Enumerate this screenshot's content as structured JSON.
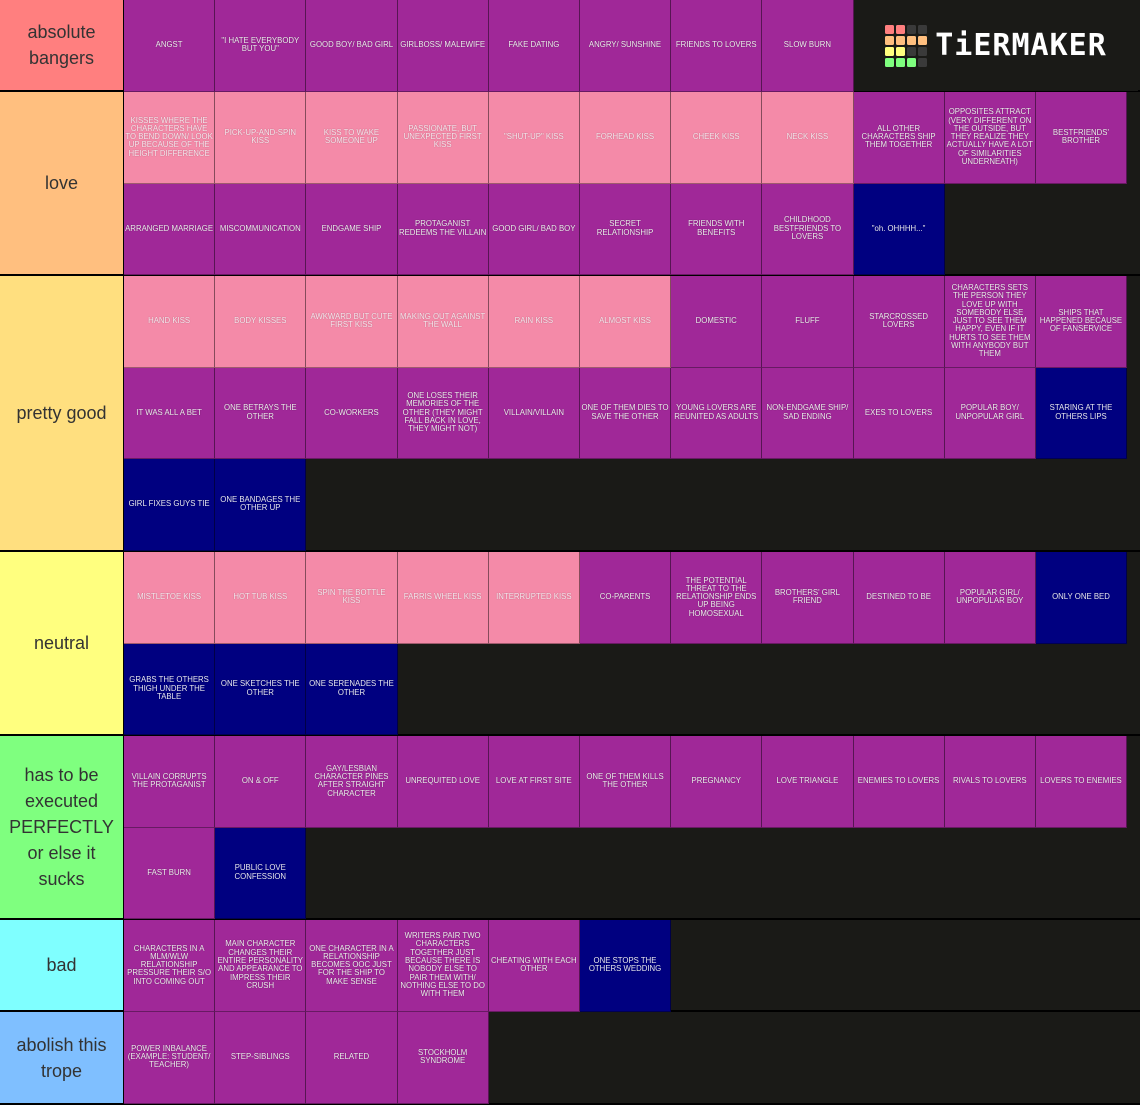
{
  "app": {
    "logo_text": "TiERMAKER",
    "logo_grid_colors": [
      "#ff7f7f",
      "#ff7f7f",
      "#3a3a3a",
      "#3a3a3a",
      "#ffbf7f",
      "#ffbf7f",
      "#ffbf7f",
      "#ffbf7f",
      "#ffff7f",
      "#ffff7f",
      "#3a3a3a",
      "#3a3a3a",
      "#7fff7f",
      "#7fff7f",
      "#7fff7f",
      "#3a3a3a"
    ]
  },
  "colors": {
    "purple": "#a02898",
    "pink": "#f48aa8",
    "navy": "#000080",
    "empty": "#1a1a17"
  },
  "tiers": [
    {
      "label": "absolute bangers",
      "color": "#ff7f7f",
      "items": [
        {
          "text": "ANGST",
          "color": "purple"
        },
        {
          "text": "\"I HATE EVERYBODY BUT YOU\"",
          "color": "purple"
        },
        {
          "text": "GOOD BOY/ BAD GIRL",
          "color": "purple"
        },
        {
          "text": "GIRLBOSS/ MALEWIFE",
          "color": "purple"
        },
        {
          "text": "FAKE DATING",
          "color": "purple"
        },
        {
          "text": "ANGRY/ SUNSHINE",
          "color": "purple"
        },
        {
          "text": "FRIENDS TO LOVERS",
          "color": "purple"
        },
        {
          "text": "SLOW BURN",
          "color": "purple"
        }
      ]
    },
    {
      "label": "love",
      "color": "#ffbf7f",
      "items": [
        {
          "text": "KISSES WHERE THE CHARACTERS HAVE TO BEND DOWN/ LOOK UP BECAUSE OF THE HEIGHT DIFFERENCE",
          "color": "pink"
        },
        {
          "text": "PICK-UP-AND-SPIN KISS",
          "color": "pink"
        },
        {
          "text": "KISS TO WAKE SOMEONE UP",
          "color": "pink"
        },
        {
          "text": "PASSIONATE, BUT UNEXPECTED FIRST KISS",
          "color": "pink"
        },
        {
          "text": "\"SHUT-UP\" KISS",
          "color": "pink"
        },
        {
          "text": "FORHEAD KISS",
          "color": "pink"
        },
        {
          "text": "CHEEK KISS",
          "color": "pink"
        },
        {
          "text": "NECK KISS",
          "color": "pink"
        },
        {
          "text": "ALL OTHER CHARACTERS SHIP THEM TOGETHER",
          "color": "purple"
        },
        {
          "text": "OPPOSITES ATTRACT (VERY DIFFERENT ON THE OUTSIDE, BUT THEY REALIZE THEY ACTUALLY HAVE A LOT OF SIMILARITIES UNDERNEATH)",
          "color": "purple"
        },
        {
          "text": "BESTFRIENDS' BROTHER",
          "color": "purple"
        },
        {
          "text": "ARRANGED MARRIAGE",
          "color": "purple"
        },
        {
          "text": "MISCOMMUNICATION",
          "color": "purple"
        },
        {
          "text": "ENDGAME SHIP",
          "color": "purple"
        },
        {
          "text": "PROTAGANIST REDEEMS THE VILLAIN",
          "color": "purple"
        },
        {
          "text": "GOOD GIRL/ BAD BOY",
          "color": "purple"
        },
        {
          "text": "SECRET RELATIONSHIP",
          "color": "purple"
        },
        {
          "text": "FRIENDS WITH BENEFITS",
          "color": "purple"
        },
        {
          "text": "CHILDHOOD BESTFRIENDS TO LOVERS",
          "color": "purple"
        },
        {
          "text": "\"oh. OHHHH...\"",
          "color": "navy",
          "lower": true
        }
      ]
    },
    {
      "label": "pretty good",
      "color": "#ffdf7f",
      "items": [
        {
          "text": "HAND KISS",
          "color": "pink"
        },
        {
          "text": "BODY KISSES",
          "color": "pink"
        },
        {
          "text": "AWKWARD BUT CUTE FIRST KISS",
          "color": "pink"
        },
        {
          "text": "MAKING OUT AGAINST THE WALL",
          "color": "pink"
        },
        {
          "text": "RAIN KISS",
          "color": "pink"
        },
        {
          "text": "ALMOST KISS",
          "color": "pink"
        },
        {
          "text": "DOMESTIC",
          "color": "purple"
        },
        {
          "text": "FLUFF",
          "color": "purple"
        },
        {
          "text": "STARCROSSED LOVERS",
          "color": "purple"
        },
        {
          "text": "CHARACTERS SETS THE PERSON THEY LOVE UP WITH SOMEBODY ELSE JUST TO SEE THEM HAPPY, EVEN IF IT HURTS TO SEE THEM WITH ANYBODY BUT THEM",
          "color": "purple"
        },
        {
          "text": "SHIPS THAT HAPPENED BECAUSE OF FANSERVICE",
          "color": "purple"
        },
        {
          "text": "IT WAS ALL A BET",
          "color": "purple"
        },
        {
          "text": "ONE BETRAYS THE OTHER",
          "color": "purple"
        },
        {
          "text": "CO-WORKERS",
          "color": "purple"
        },
        {
          "text": "ONE LOSES THEIR MEMORIES OF THE OTHER (THEY MIGHT FALL BACK IN LOVE, THEY MIGHT NOT)",
          "color": "purple"
        },
        {
          "text": "VILLAIN/VILLAIN",
          "color": "purple"
        },
        {
          "text": "ONE OF THEM DIES TO SAVE THE OTHER",
          "color": "purple"
        },
        {
          "text": "YOUNG LOVERS ARE REUNITED AS ADULTS",
          "color": "purple"
        },
        {
          "text": "NON-ENDGAME SHIP/ SAD ENDING",
          "color": "purple"
        },
        {
          "text": "EXES TO LOVERS",
          "color": "purple"
        },
        {
          "text": "POPULAR BOY/ UNPOPULAR GIRL",
          "color": "purple"
        },
        {
          "text": "STARING AT THE OTHERS LIPS",
          "color": "navy"
        },
        {
          "text": "GIRL FIXES GUYS TIE",
          "color": "navy"
        },
        {
          "text": "ONE BANDAGES THE OTHER UP",
          "color": "navy"
        }
      ]
    },
    {
      "label": "neutral",
      "color": "#ffff7f",
      "items": [
        {
          "text": "MISTLETOE KISS",
          "color": "pink"
        },
        {
          "text": "HOT TUB KISS",
          "color": "pink"
        },
        {
          "text": "SPIN THE BOTTLE KISS",
          "color": "pink"
        },
        {
          "text": "FARRIS WHEEL KISS",
          "color": "pink"
        },
        {
          "text": "INTERRUPTED KISS",
          "color": "pink"
        },
        {
          "text": "CO-PARENTS",
          "color": "purple"
        },
        {
          "text": "THE POTENTIAL THREAT TO THE RELATIONSHIP ENDS UP BEING HOMOSEXUAL",
          "color": "purple"
        },
        {
          "text": "BROTHERS' GIRL FRIEND",
          "color": "purple"
        },
        {
          "text": "DESTINED TO BE",
          "color": "purple"
        },
        {
          "text": "POPULAR GIRL/ UNPOPULAR BOY",
          "color": "purple"
        },
        {
          "text": "ONLY ONE BED",
          "color": "navy"
        },
        {
          "text": "GRABS THE OTHERS THIGH UNDER THE TABLE",
          "color": "navy"
        },
        {
          "text": "ONE SKETCHES THE OTHER",
          "color": "navy"
        },
        {
          "text": "ONE SERENADES THE OTHER",
          "color": "navy"
        }
      ]
    },
    {
      "label": "has to be executed PERFECTLY or else it sucks",
      "color": "#7fff7f",
      "items": [
        {
          "text": "VILLAIN CORRUPTS THE PROTAGANIST",
          "color": "purple"
        },
        {
          "text": "ON & OFF",
          "color": "purple"
        },
        {
          "text": "GAY/LESBIAN CHARACTER PINES AFTER STRAIGHT CHARACTER",
          "color": "purple"
        },
        {
          "text": "UNREQUITED LOVE",
          "color": "purple"
        },
        {
          "text": "LOVE AT FIRST SITE",
          "color": "purple"
        },
        {
          "text": "ONE OF THEM KILLS THE OTHER",
          "color": "purple"
        },
        {
          "text": "PREGNANCY",
          "color": "purple"
        },
        {
          "text": "LOVE TRIANGLE",
          "color": "purple"
        },
        {
          "text": "ENEMIES TO LOVERS",
          "color": "purple"
        },
        {
          "text": "RIVALS TO LOVERS",
          "color": "purple"
        },
        {
          "text": "LOVERS TO ENEMIES",
          "color": "purple"
        },
        {
          "text": "FAST BURN",
          "color": "purple"
        },
        {
          "text": "PUBLIC LOVE CONFESSION",
          "color": "navy"
        }
      ]
    },
    {
      "label": "bad",
      "color": "#7fffff",
      "items": [
        {
          "text": "CHARACTERS IN A MLM/WLW RELATIONSHIP PRESSURE THEIR S/O INTO COMING OUT",
          "color": "purple"
        },
        {
          "text": "MAIN CHARACTER CHANGES THEIR ENTIRE PERSONALITY AND APPEARANCE TO IMPRESS THEIR CRUSH",
          "color": "purple"
        },
        {
          "text": "ONE CHARACTER IN A RELATIONSHIP BECOMES OOC JUST FOR THE SHIP TO MAKE SENSE",
          "color": "purple"
        },
        {
          "text": "WRITERS PAIR TWO CHARACTERS TOGETHER JUST BECAUSE THERE IS NOBODY ELSE TO PAIR THEM WITH/ NOTHING ELSE TO DO WITH THEM",
          "color": "purple"
        },
        {
          "text": "CHEATING WITH EACH OTHER",
          "color": "purple"
        },
        {
          "text": "ONE STOPS THE OTHERS WEDDING",
          "color": "navy"
        }
      ]
    },
    {
      "label": "abolish this trope",
      "color": "#7fbfff",
      "items": [
        {
          "text": "POWER INBALANCE (EXAMPLE: STUDENT/ TEACHER)",
          "color": "purple"
        },
        {
          "text": "STEP-SIBLINGS",
          "color": "purple"
        },
        {
          "text": "RELATED",
          "color": "purple"
        },
        {
          "text": "STOCKHOLM SYNDROME",
          "color": "purple"
        }
      ]
    }
  ]
}
